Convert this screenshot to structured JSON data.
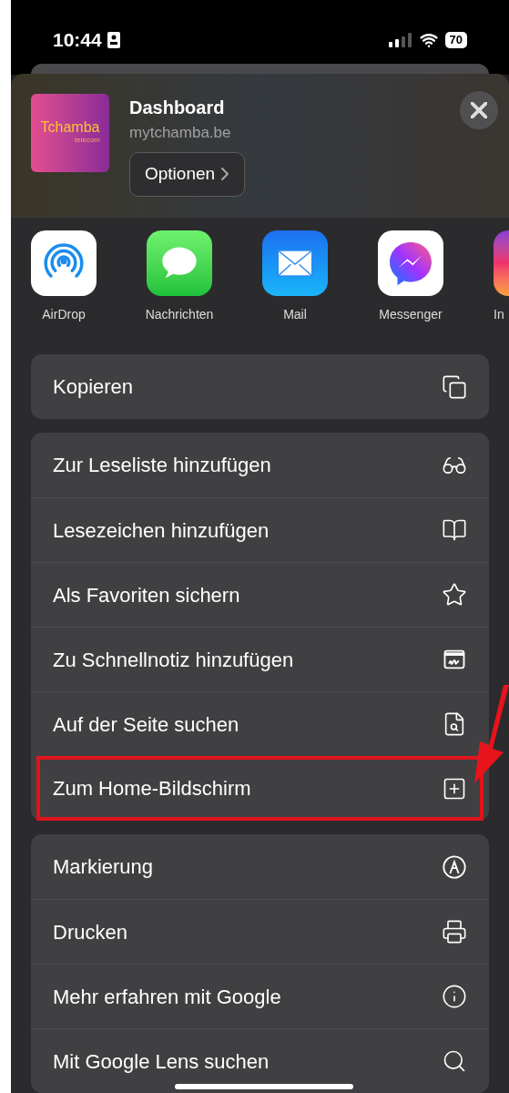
{
  "status_bar": {
    "time": "10:44",
    "battery": "70"
  },
  "header": {
    "logo_title": "Tchamba",
    "logo_subtitle": "telecom",
    "title": "Dashboard",
    "url": "mytchamba.be",
    "options_button": "Optionen"
  },
  "apps": [
    {
      "label": "AirDrop"
    },
    {
      "label": "Nachrichten"
    },
    {
      "label": "Mail"
    },
    {
      "label": "Messenger"
    },
    {
      "label": "In"
    }
  ],
  "groups": [
    {
      "items": [
        {
          "label": "Kopieren",
          "highlighted": false
        }
      ]
    },
    {
      "items": [
        {
          "label": "Zur Leseliste hinzufügen",
          "highlighted": false
        },
        {
          "label": "Lesezeichen hinzufügen",
          "highlighted": false
        },
        {
          "label": "Als Favoriten sichern",
          "highlighted": false
        },
        {
          "label": "Zu Schnellnotiz hinzufügen",
          "highlighted": false
        },
        {
          "label": "Auf der Seite suchen",
          "highlighted": false
        },
        {
          "label": "Zum Home-Bildschirm",
          "highlighted": true
        }
      ]
    },
    {
      "items": [
        {
          "label": "Markierung",
          "highlighted": false
        },
        {
          "label": "Drucken",
          "highlighted": false
        },
        {
          "label": "Mehr erfahren mit Google",
          "highlighted": false
        },
        {
          "label": "Mit Google Lens suchen",
          "highlighted": false
        }
      ]
    }
  ]
}
